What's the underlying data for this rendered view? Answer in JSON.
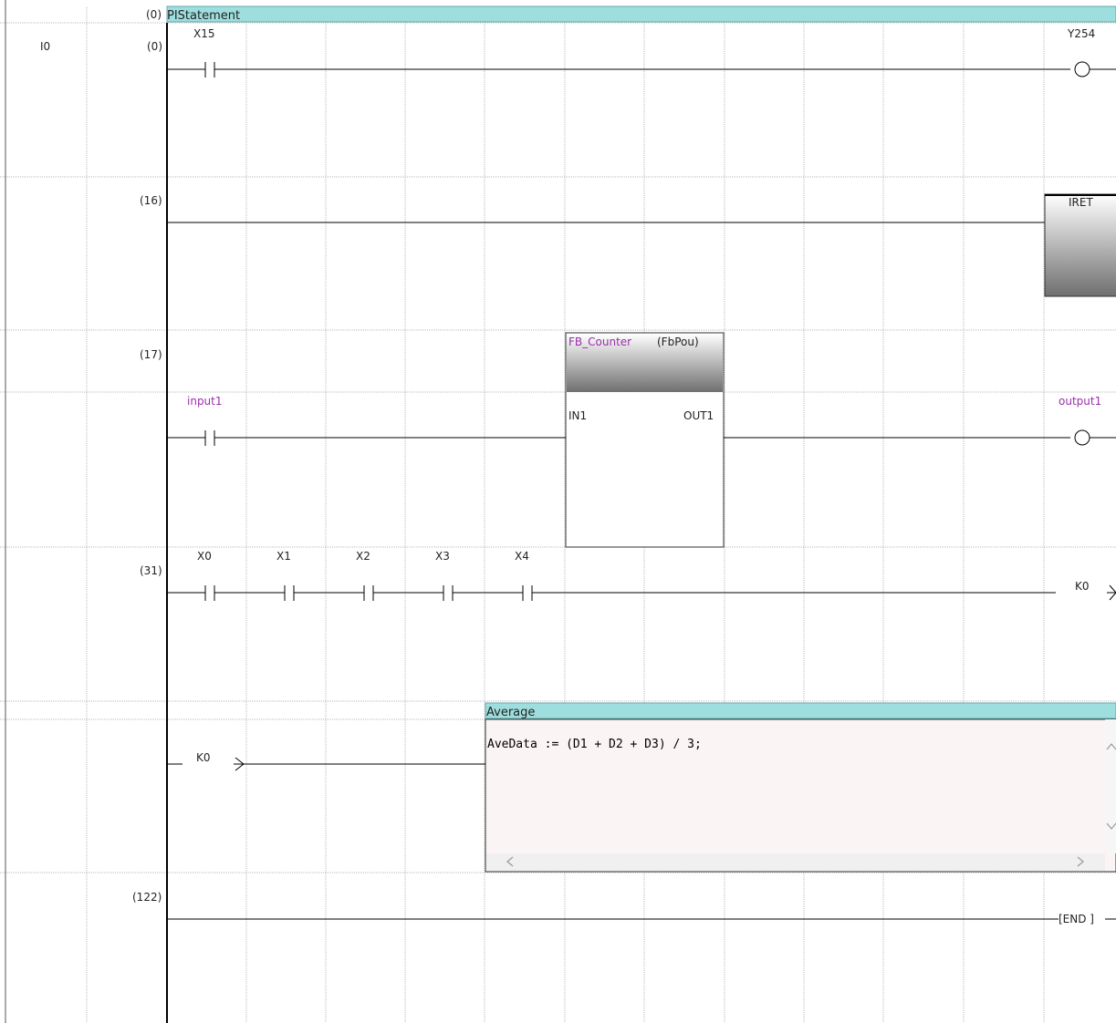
{
  "editor": {
    "interrupt_pointer": "I0",
    "steps": {
      "s0_header": "(0)",
      "s0": "(0)",
      "s16": "(16)",
      "s17": "(17)",
      "s31": "(31)",
      "s122": "(122)"
    }
  },
  "header_bar": {
    "title": "PIStatement"
  },
  "rungs": {
    "r0": {
      "contact": "X15",
      "coil": "Y254"
    },
    "r16": {
      "instruction": "IRET"
    },
    "r17": {
      "fb_instance": "FB_Counter",
      "fb_type": "(FbPou)",
      "input_label": "input1",
      "output_label": "output1",
      "in_pin": "IN1",
      "out_pin": "OUT1"
    },
    "r31": {
      "contacts": [
        "X0",
        "X1",
        "X2",
        "X3",
        "X4"
      ],
      "jump_out": "K0"
    },
    "st_block": {
      "title": "Average",
      "code": "AveData := (D1 + D2 + D3) / 3;",
      "jump_in": "K0"
    },
    "r122": {
      "end_instruction": "[END  ]"
    }
  },
  "colors": {
    "header_bar": "#9fdede",
    "st_background": "#fbf4f4",
    "fb_instance_text": "#9b2fae",
    "label_text": "#9b2fae"
  },
  "icons": {
    "scroll_left": "chevron-left-icon",
    "scroll_right": "chevron-right-icon",
    "scroll_up": "chevron-up-icon",
    "scroll_down": "chevron-down-icon"
  }
}
